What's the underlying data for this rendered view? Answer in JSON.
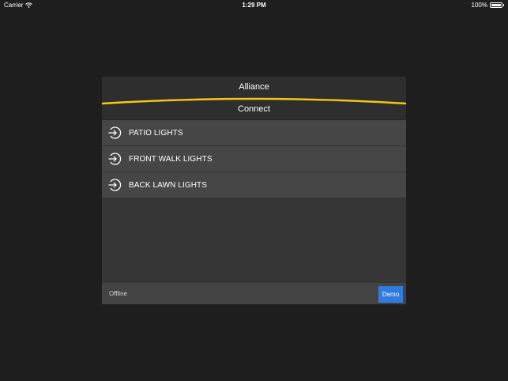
{
  "status_bar": {
    "carrier": "Carrier",
    "time": "1:29 PM",
    "battery": "100%",
    "battery_level": 1.0,
    "wifi_icon": "wifi-icon",
    "battery_icon": "battery-icon"
  },
  "panel": {
    "title": "Alliance",
    "subtitle": "Connect",
    "accent_color": "#f5c518",
    "items": [
      {
        "label": "PATIO LIGHTS",
        "icon": "connect-arrow-icon"
      },
      {
        "label": "FRONT WALK LIGHTS",
        "icon": "connect-arrow-icon"
      },
      {
        "label": "BACK LAWN LIGHTS",
        "icon": "connect-arrow-icon"
      }
    ]
  },
  "footer": {
    "status": "Offline",
    "demo_label": "Demo",
    "demo_color": "#2f7be0"
  }
}
